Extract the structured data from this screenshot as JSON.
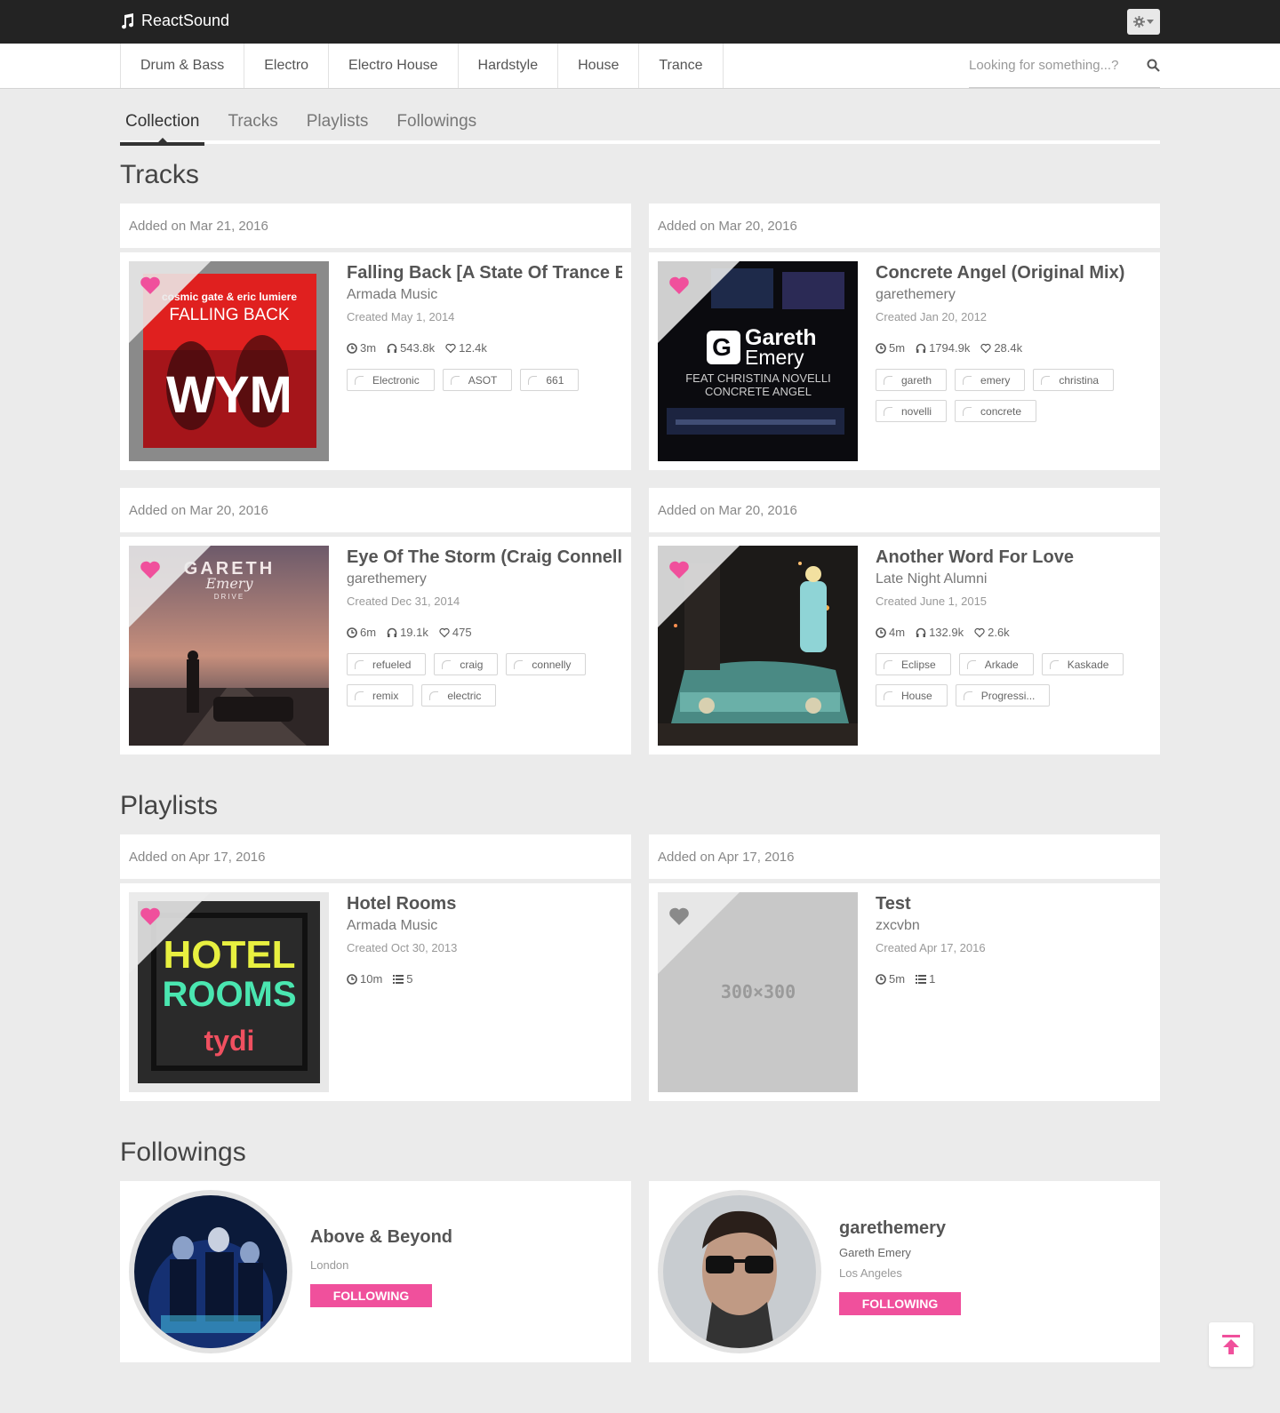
{
  "app": {
    "name": "ReactSound"
  },
  "nav": {
    "genres": [
      "Drum & Bass",
      "Electro",
      "Electro House",
      "Hardstyle",
      "House",
      "Trance"
    ],
    "search_placeholder": "Looking for something...?"
  },
  "tabs": [
    {
      "label": "Collection",
      "active": true
    },
    {
      "label": "Tracks",
      "active": false
    },
    {
      "label": "Playlists",
      "active": false
    },
    {
      "label": "Followings",
      "active": false
    }
  ],
  "sections": {
    "tracks": "Tracks",
    "playlists": "Playlists",
    "followings": "Followings"
  },
  "tracks": [
    {
      "added": "Added on Mar 21, 2016",
      "title": "Falling Back [A State Of Trance E...",
      "artist": "Armada Music",
      "created": "Created May 1, 2014",
      "duration": "3m",
      "plays": "543.8k",
      "likes": "12.4k",
      "tags": [
        "Electronic",
        "ASOT",
        "661"
      ],
      "liked": true,
      "art_text": [
        "cosmic gate & eric lumiere",
        "FALLING BACK",
        "WYM"
      ]
    },
    {
      "added": "Added on Mar 20, 2016",
      "title": "Concrete Angel (Original Mix)",
      "artist": "garethemery",
      "created": "Created Jan 20, 2012",
      "duration": "5m",
      "plays": "1794.9k",
      "likes": "28.4k",
      "tags": [
        "gareth",
        "emery",
        "christina",
        "novelli",
        "concrete"
      ],
      "liked": true,
      "art_text": [
        "Gareth",
        "Emery",
        "FEAT CHRISTINA NOVELLI",
        "CONCRETE ANGEL"
      ]
    },
    {
      "added": "Added on Mar 20, 2016",
      "title": "Eye Of The Storm (Craig Connell...",
      "artist": "garethemery",
      "created": "Created Dec 31, 2014",
      "duration": "6m",
      "plays": "19.1k",
      "likes": "475",
      "tags": [
        "refueled",
        "craig",
        "connelly",
        "remix",
        "electric"
      ],
      "liked": true,
      "art_text": [
        "GARETH",
        "Emery",
        "DRIVE"
      ]
    },
    {
      "added": "Added on Mar 20, 2016",
      "title": "Another Word For Love",
      "artist": "Late Night Alumni",
      "created": "Created June 1, 2015",
      "duration": "4m",
      "plays": "132.9k",
      "likes": "2.6k",
      "tags": [
        "Eclipse",
        "Arkade",
        "Kaskade",
        "House",
        "Progressi..."
      ],
      "liked": true,
      "art_text": []
    }
  ],
  "playlists": [
    {
      "added": "Added on Apr 17, 2016",
      "title": "Hotel Rooms",
      "artist": "Armada Music",
      "created": "Created Oct 30, 2013",
      "duration": "10m",
      "track_count": "5",
      "liked": true,
      "art_text": [
        "HOTEL",
        "ROOMS",
        "tydi"
      ]
    },
    {
      "added": "Added on Apr 17, 2016",
      "title": "Test",
      "artist": "zxcvbn",
      "created": "Created Apr 17, 2016",
      "duration": "5m",
      "track_count": "1",
      "liked": false,
      "art_text": [
        "300×300"
      ]
    }
  ],
  "followings": [
    {
      "name": "Above & Beyond",
      "full_name": "",
      "location": "London",
      "button": "FOLLOWING"
    },
    {
      "name": "garethemery",
      "full_name": "Gareth Emery",
      "location": "Los Angeles",
      "button": "FOLLOWING"
    }
  ],
  "colors": {
    "accent": "#f0509c",
    "topbar": "#232323",
    "background": "#ebebeb"
  },
  "icons": [
    "music-note-icon",
    "gear-icon",
    "caret-down-icon",
    "search-icon",
    "heart-icon",
    "clock-icon",
    "headphones-icon",
    "heart-outline-icon",
    "list-icon",
    "tag-icon",
    "arrow-up-icon"
  ]
}
